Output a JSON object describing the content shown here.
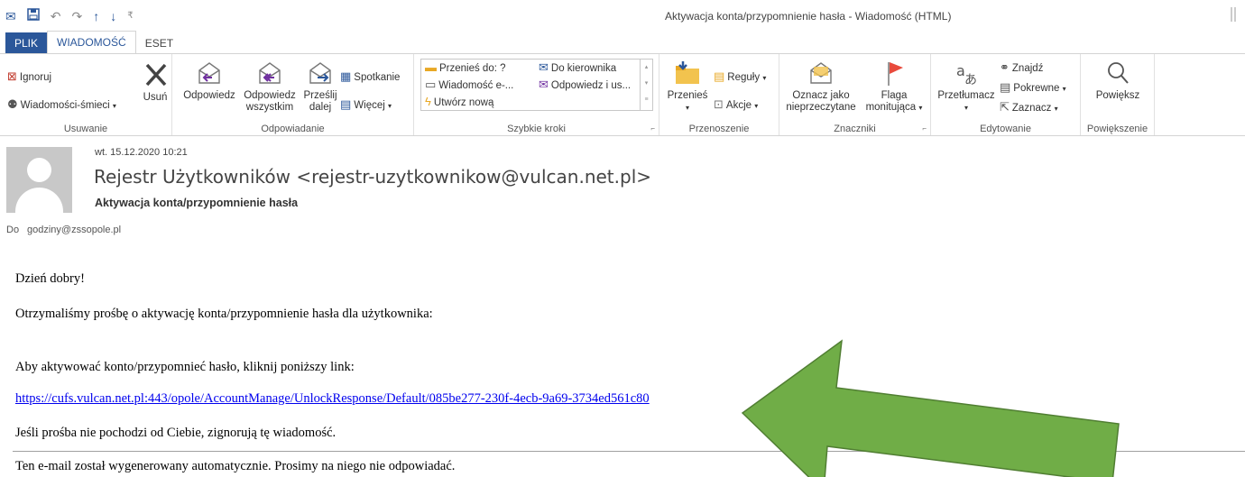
{
  "window": {
    "title": "Aktywacja konta/przypomnienie hasła - Wiadomość (HTML)"
  },
  "tabs": [
    {
      "label": "PLIK"
    },
    {
      "label": "WIADOMOŚĆ"
    },
    {
      "label": "ESET"
    }
  ],
  "ribbon": {
    "usuwanie": {
      "label": "Usuwanie",
      "ignore": "Ignoruj",
      "junk": "Wiadomości-śmieci",
      "delete": "Usuń"
    },
    "odpowiadanie": {
      "label": "Odpowiadanie",
      "reply": "Odpowiedz",
      "reply_all_1": "Odpowiedz",
      "reply_all_2": "wszystkim",
      "forward_1": "Prześlij",
      "forward_2": "dalej",
      "meeting": "Spotkanie",
      "more": "Więcej"
    },
    "szybkie_kroki": {
      "label": "Szybkie kroki",
      "move_to": "Przenieś do: ?",
      "to_manager": "Do kierownika",
      "email": "Wiadomość e-...",
      "reply_delete": "Odpowiedz i us...",
      "create_new": "Utwórz nową"
    },
    "przenoszenie": {
      "label": "Przenoszenie",
      "move": "Przenieś",
      "rules": "Reguły",
      "actions": "Akcje"
    },
    "znaczniki": {
      "label": "Znaczniki",
      "mark_unread_1": "Oznacz jako",
      "mark_unread_2": "nieprzeczytane",
      "flag_1": "Flaga",
      "flag_2": "monitująca"
    },
    "edytowanie": {
      "label": "Edytowanie",
      "translate": "Przetłumacz",
      "find": "Znajdź",
      "related": "Pokrewne",
      "select": "Zaznacz"
    },
    "powiekszenie": {
      "label": "Powiększenie",
      "zoom": "Powiększ"
    }
  },
  "message": {
    "date": "wt. 15.12.2020 10:21",
    "from": "Rejestr Użytkowników <rejestr-uzytkownikow@vulcan.net.pl>",
    "subject": "Aktywacja konta/przypomnienie hasła",
    "to_label": "Do",
    "to": "godziny@zssopole.pl"
  },
  "body": {
    "greeting": "Dzień dobry!",
    "line1": "Otrzymaliśmy prośbę o aktywację konta/przypomnienie hasła dla użytkownika:",
    "line2": "Aby aktywować konto/przypomnieć hasło, kliknij poniższy link:",
    "link": "https://cufs.vulcan.net.pl:443/opole/AccountManage/UnlockResponse/Default/085be277-230f-4ecb-9a69-3734ed561c80",
    "line3": "Jeśli prośba nie pochodzi od Ciebie, zignorują tę wiadomość.",
    "footer": "Ten e-mail został wygenerowany automatycznie. Prosimy na niego nie odpowiadać."
  },
  "colors": {
    "accent": "#2b579a",
    "arrow": "#70ad47",
    "link": "#0000ee"
  }
}
